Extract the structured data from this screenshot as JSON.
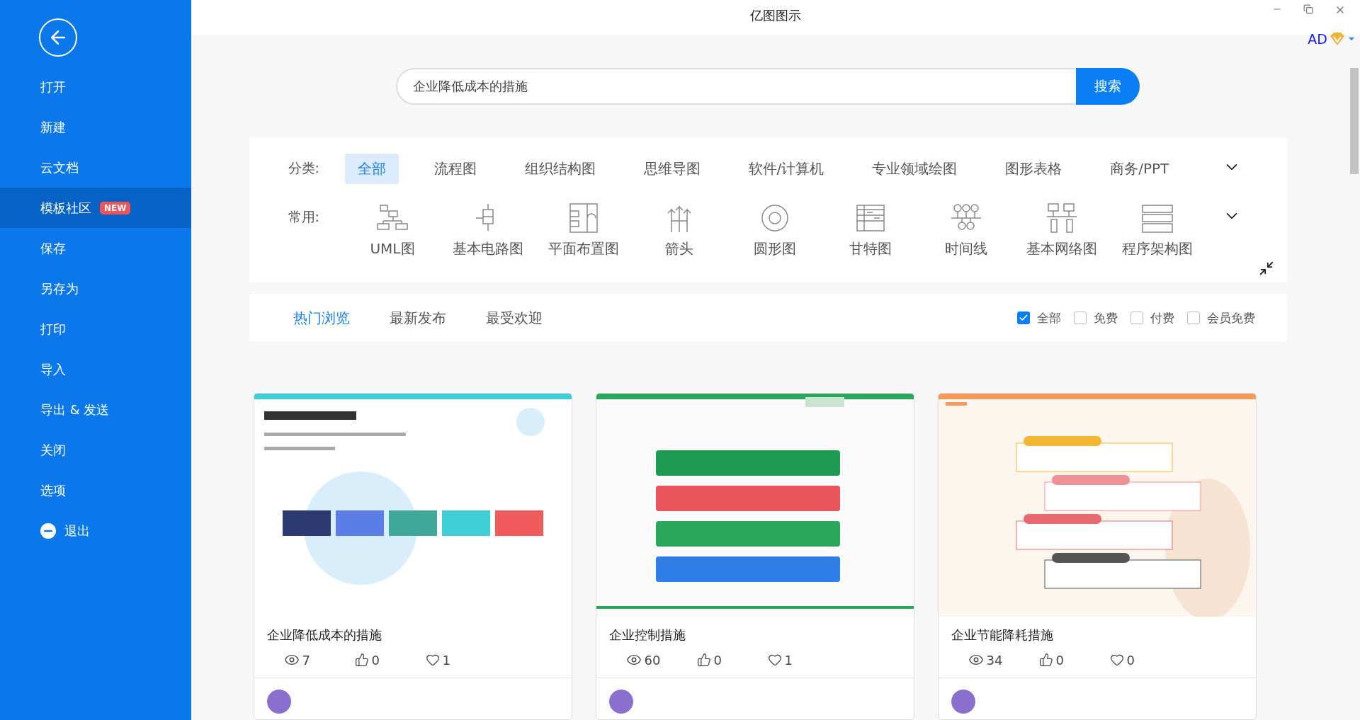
{
  "window": {
    "title": "亿图图示",
    "user": "AD"
  },
  "sidebar": {
    "items": [
      {
        "label": "打开",
        "selected": false
      },
      {
        "label": "新建",
        "selected": false
      },
      {
        "label": "云文档",
        "selected": false
      },
      {
        "label": "模板社区",
        "selected": true,
        "badge": "NEW"
      },
      {
        "label": "保存",
        "selected": false
      },
      {
        "label": "另存为",
        "selected": false
      },
      {
        "label": "打印",
        "selected": false
      },
      {
        "label": "导入",
        "selected": false
      },
      {
        "label": "导出 & 发送",
        "selected": false
      },
      {
        "label": "关闭",
        "selected": false
      },
      {
        "label": "选项",
        "selected": false
      },
      {
        "label": "退出",
        "selected": false,
        "kind": "exit"
      }
    ]
  },
  "search": {
    "value": "企业降低成本的措施",
    "button": "搜索"
  },
  "categories": {
    "label": "分类:",
    "items": [
      {
        "label": "全部",
        "selected": true
      },
      {
        "label": "流程图",
        "selected": false
      },
      {
        "label": "组织结构图",
        "selected": false
      },
      {
        "label": "思维导图",
        "selected": false
      },
      {
        "label": "软件/计算机",
        "selected": false
      },
      {
        "label": "专业领域绘图",
        "selected": false
      },
      {
        "label": "图形表格",
        "selected": false
      },
      {
        "label": "商务/PPT",
        "selected": false
      }
    ]
  },
  "common": {
    "label": "常用:",
    "items": [
      {
        "label": "UML图",
        "kind": "uml"
      },
      {
        "label": "基本电路图",
        "kind": "circuit"
      },
      {
        "label": "平面布置图",
        "kind": "floor"
      },
      {
        "label": "箭头",
        "kind": "arrow"
      },
      {
        "label": "圆形图",
        "kind": "circle"
      },
      {
        "label": "甘特图",
        "kind": "gantt"
      },
      {
        "label": "时间线",
        "kind": "timeline"
      },
      {
        "label": "基本网络图",
        "kind": "network"
      },
      {
        "label": "程序架构图",
        "kind": "arch"
      }
    ]
  },
  "sort_tabs": [
    {
      "label": "热门浏览",
      "selected": true
    },
    {
      "label": "最新发布",
      "selected": false
    },
    {
      "label": "最受欢迎",
      "selected": false
    }
  ],
  "filters": [
    {
      "label": "全部",
      "checked": true
    },
    {
      "label": "免费",
      "checked": false
    },
    {
      "label": "付费",
      "checked": false
    },
    {
      "label": "会员免费",
      "checked": false
    }
  ],
  "templates": [
    {
      "title": "企业降低成本的措施",
      "kind": "blue",
      "views": "7",
      "likes": "0",
      "favorites": "1"
    },
    {
      "title": "企业控制措施",
      "kind": "green",
      "views": "60",
      "likes": "0",
      "favorites": "1"
    },
    {
      "title": "企业节能降耗措施",
      "kind": "orange",
      "views": "34",
      "likes": "0",
      "favorites": "0"
    }
  ]
}
